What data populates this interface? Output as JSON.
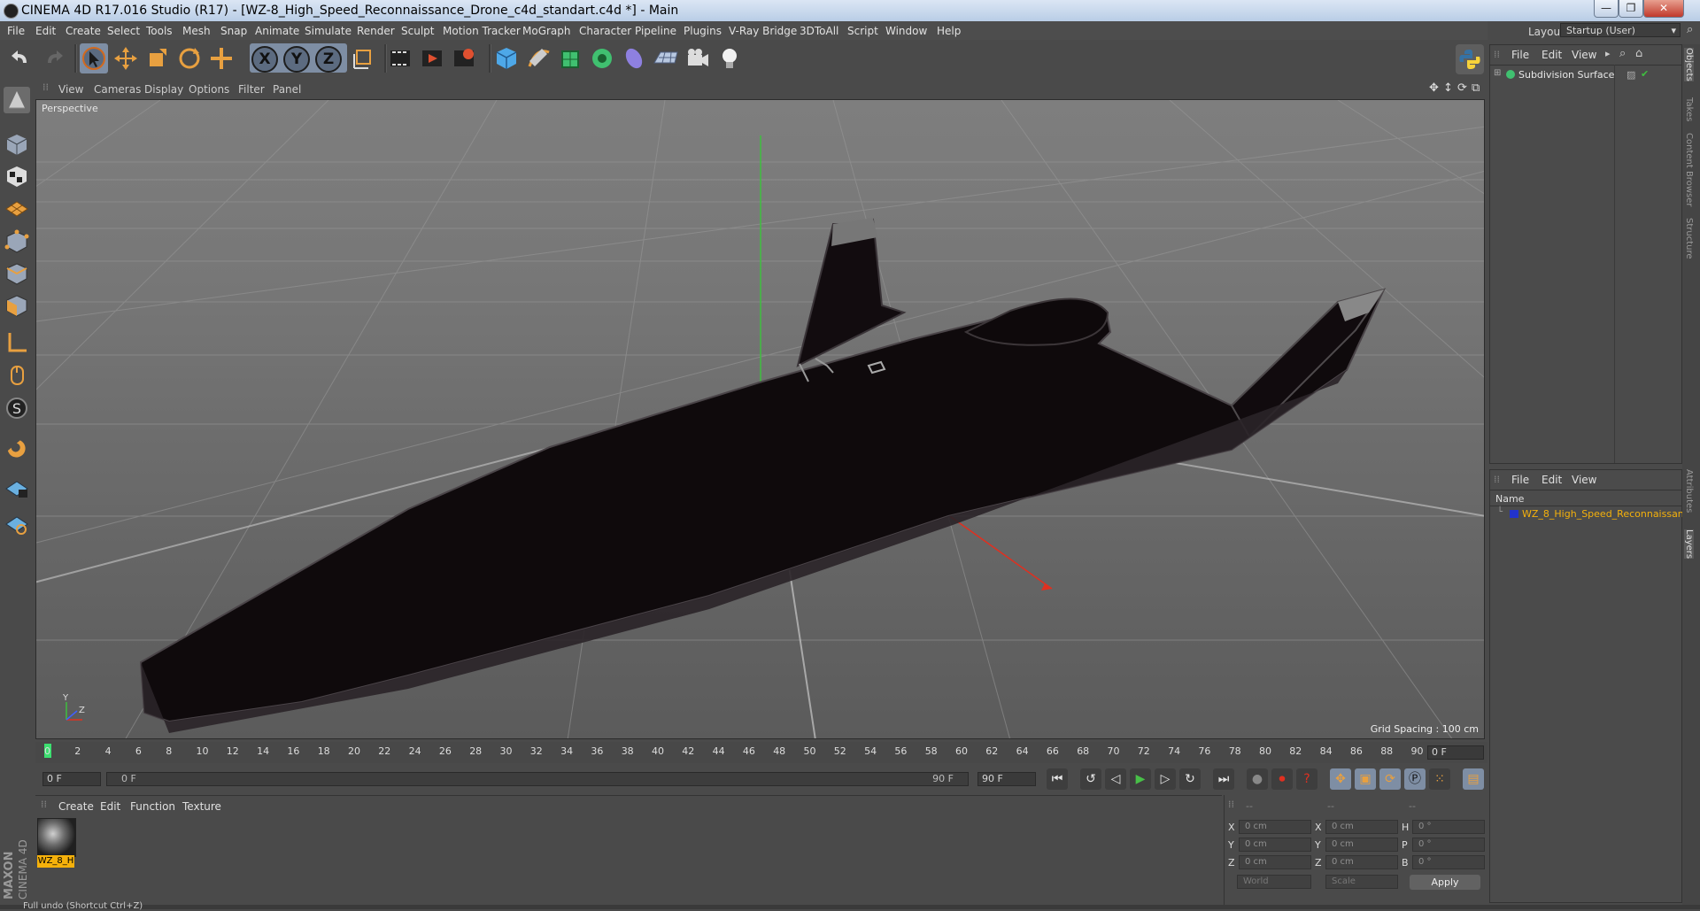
{
  "window": {
    "title": "CINEMA 4D R17.016 Studio (R17) - [WZ-8_High_Speed_Reconnaissance_Drone_c4d_standart.c4d *] - Main",
    "min": "—",
    "max": "❐",
    "close": "✕"
  },
  "menu": [
    "File",
    "Edit",
    "Create",
    "Select",
    "Tools",
    "Mesh",
    "Snap",
    "Animate",
    "Simulate",
    "Render",
    "Sculpt",
    "Motion Tracker",
    "MoGraph",
    "Character",
    "Pipeline",
    "Plugins",
    "V-Ray Bridge",
    "3DToAll",
    "Script",
    "Window",
    "Help"
  ],
  "layout": {
    "label": "Layout:",
    "value": "Startup (User)"
  },
  "axis_buttons": [
    "X",
    "Y",
    "Z"
  ],
  "viewport": {
    "menu": [
      "View",
      "Cameras",
      "Display",
      "Options",
      "Filter",
      "Panel"
    ],
    "camera_label": "Perspective",
    "grid_spacing": "Grid Spacing : 100 cm",
    "axis_y": "Y",
    "axis_z": "Z"
  },
  "timeline": {
    "ticks": [
      "0",
      "2",
      "4",
      "6",
      "8",
      "10",
      "12",
      "14",
      "16",
      "18",
      "20",
      "22",
      "24",
      "26",
      "28",
      "30",
      "32",
      "34",
      "36",
      "38",
      "40",
      "42",
      "44",
      "46",
      "48",
      "50",
      "52",
      "54",
      "56",
      "58",
      "60",
      "62",
      "64",
      "66",
      "68",
      "70",
      "72",
      "74",
      "76",
      "78",
      "80",
      "82",
      "84",
      "86",
      "88",
      "90"
    ],
    "current_frame": "0 F",
    "start_field": "0 F",
    "range_start": "0 F",
    "range_end": "90 F",
    "end_field": "90 F"
  },
  "material_manager": {
    "menu": [
      "Create",
      "Edit",
      "Function",
      "Texture"
    ],
    "material_label": "WZ_8_H"
  },
  "coords": {
    "headers": [
      "--",
      "--",
      "--"
    ],
    "rows": [
      {
        "a_lbl": "X",
        "a_val": "0 cm",
        "b_lbl": "X",
        "b_val": "0 cm",
        "c_lbl": "H",
        "c_val": "0 °"
      },
      {
        "a_lbl": "Y",
        "a_val": "0 cm",
        "b_lbl": "Y",
        "b_val": "0 cm",
        "c_lbl": "P",
        "c_val": "0 °"
      },
      {
        "a_lbl": "Z",
        "a_val": "0 cm",
        "b_lbl": "Z",
        "b_val": "0 cm",
        "c_lbl": "B",
        "c_val": "0 °"
      }
    ],
    "world": "World",
    "scale": "Scale",
    "apply": "Apply"
  },
  "objects_panel": {
    "menu": [
      "File",
      "Edit",
      "View"
    ],
    "item": "Subdivision Surface"
  },
  "layers_panel": {
    "menu": [
      "File",
      "Edit",
      "View"
    ],
    "name_header": "Name",
    "item": "WZ_8_High_Speed_Reconnaissan"
  },
  "side_tabs": [
    "Objects",
    "Takes",
    "Content Browser",
    "Structure",
    "Attributes",
    "Layers"
  ],
  "status": "Full undo (Shortcut Ctrl+Z)",
  "brand": {
    "line1": "MAXON",
    "line2": "CINEMA 4D"
  },
  "colors": {
    "accent_orange": "#f5b10b",
    "layer_blue": "#2233cc",
    "play_green": "#48c048"
  }
}
